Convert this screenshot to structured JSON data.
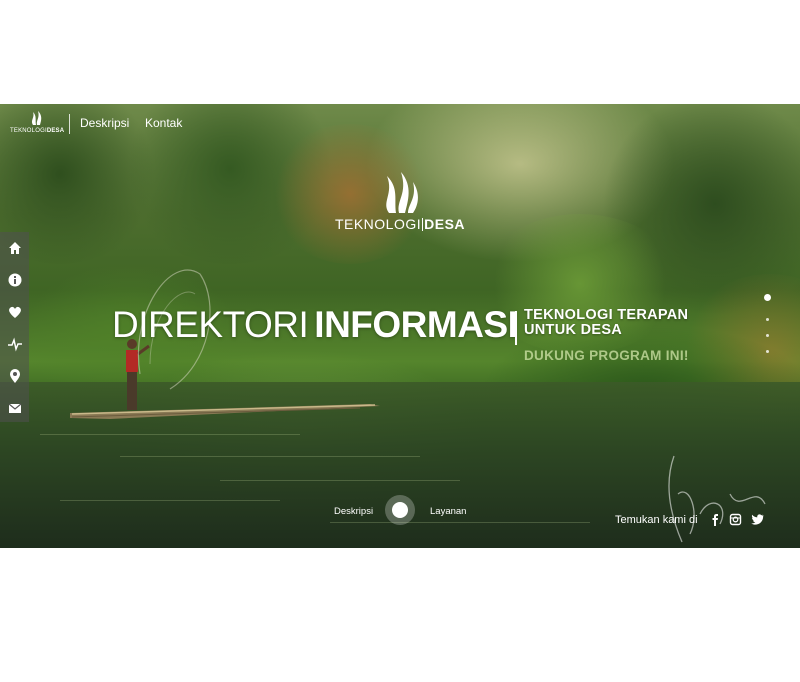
{
  "nav": {
    "logo_text_light": "TEKNOLOGI",
    "logo_text_bold": "DESA",
    "links": [
      "Deskripsi",
      "Kontak"
    ]
  },
  "hero": {
    "brand_light": "TEKNOLOGI",
    "brand_bold": "DESA",
    "headline_light": "DIREKTORI",
    "headline_bold": "INFORMASI",
    "tagline_line1": "TEKNOLOGI TERAPAN",
    "tagline_line2": "UNTUK DESA",
    "cta": "DUKUNG PROGRAM INI!"
  },
  "sidebar": {
    "icons": [
      "home-icon",
      "info-icon",
      "heart-icon",
      "pulse-icon",
      "location-pin-icon",
      "mail-icon"
    ]
  },
  "slider": {
    "left_label": "Deskripsi",
    "right_label": "Layanan"
  },
  "social": {
    "label": "Temukan kami di",
    "icons": [
      "facebook-icon",
      "instagram-icon",
      "twitter-icon"
    ]
  },
  "colors": {
    "text": "#ffffff",
    "sidebar_bg": "rgba(80,80,80,0.55)",
    "cta": "#d2e6aa"
  }
}
